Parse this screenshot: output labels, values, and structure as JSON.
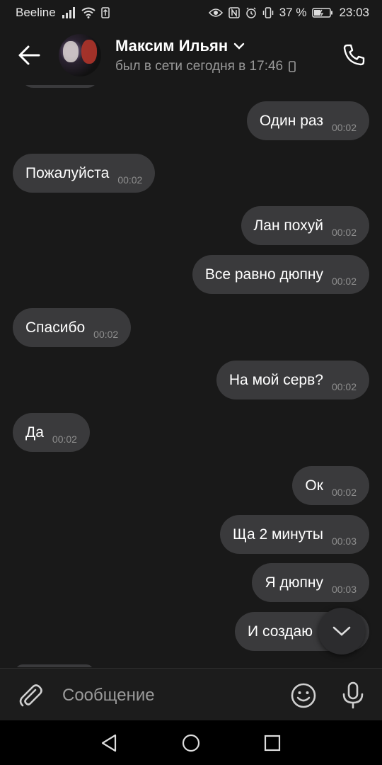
{
  "status_bar": {
    "carrier": "Beeline",
    "battery": "37 %",
    "time": "23:03"
  },
  "header": {
    "name": "Максим Ильян",
    "status": "был в сети сегодня в 17:46"
  },
  "messages": [
    {
      "text": "Один раз",
      "time": "00:02",
      "outgoing": true
    },
    {
      "text": "Пожалуйста",
      "time": "00:02",
      "outgoing": false
    },
    {
      "text": "Лан похуй",
      "time": "00:02",
      "outgoing": true
    },
    {
      "text": "Все равно дюпну",
      "time": "00:02",
      "outgoing": true
    },
    {
      "text": "Спасибо",
      "time": "00:02",
      "outgoing": false
    },
    {
      "text": "На мой серв?",
      "time": "00:02",
      "outgoing": true
    },
    {
      "text": "Да",
      "time": "00:02",
      "outgoing": false
    },
    {
      "text": "Ок",
      "time": "00:02",
      "outgoing": true
    },
    {
      "text": "Ща 2 минуты",
      "time": "00:03",
      "outgoing": true
    },
    {
      "text": "Я дюпну",
      "time": "00:03",
      "outgoing": true
    },
    {
      "text": "И создаю",
      "time": "",
      "outgoing": true
    }
  ],
  "composer": {
    "placeholder": "Сообщение"
  }
}
